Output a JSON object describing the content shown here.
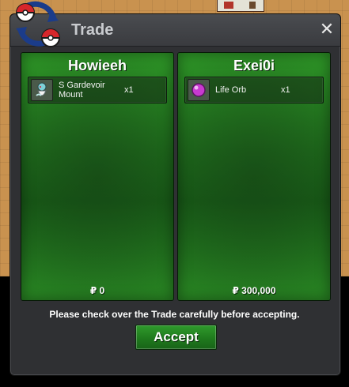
{
  "window": {
    "title": "Trade",
    "close_icon": "close-icon",
    "logo_icon": "trade-logo-icon"
  },
  "panels": [
    {
      "player_name": "Howieeh",
      "items": [
        {
          "icon": "gardevoir-mount-icon",
          "name": "S Gardevoir Mount",
          "quantity": "x1"
        }
      ],
      "money": "₽ 0"
    },
    {
      "player_name": "Exei0i",
      "items": [
        {
          "icon": "life-orb-icon",
          "name": "Life Orb",
          "quantity": "x1"
        }
      ],
      "money": "₽ 300,000"
    }
  ],
  "footer": {
    "notice": "Please check over the Trade carefully before accepting.",
    "accept_label": "Accept"
  },
  "colors": {
    "panel_green": "#1f6e1c",
    "title_bar": "#3f4044",
    "accept_green": "#2f9a2c"
  }
}
